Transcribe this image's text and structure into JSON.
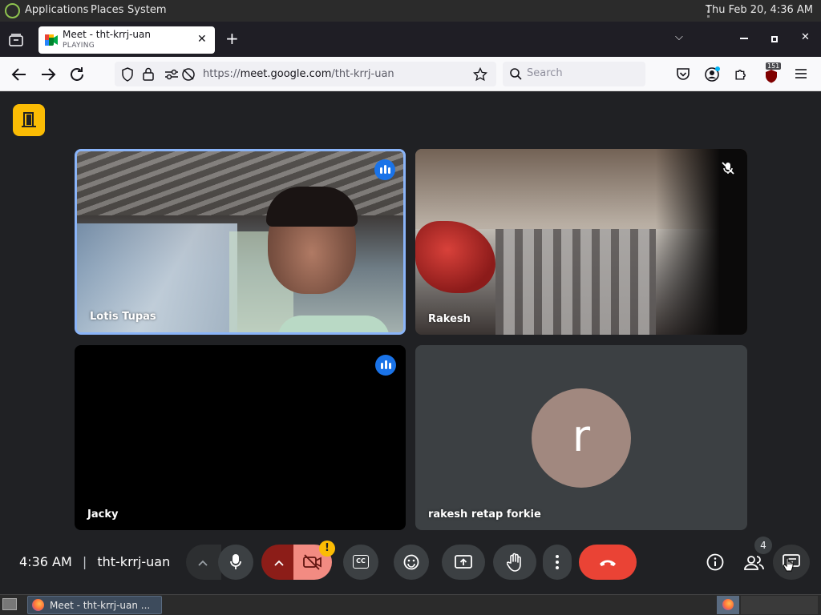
{
  "topbar": {
    "menus": [
      "Applications",
      "Places",
      "System"
    ],
    "clock": "Thu Feb 20,  4:36 AM"
  },
  "browser": {
    "tab": {
      "title": "Meet - tht-krrj-uan",
      "status": "PLAYING"
    },
    "url_prefix": "https://",
    "url_host": "meet.google.com",
    "url_path": "/tht-krrj-uan",
    "search_placeholder": "Search",
    "ext_badge": "151"
  },
  "meet": {
    "participants": [
      {
        "name": "Lotis Tupas"
      },
      {
        "name": "Rakesh"
      },
      {
        "name": "Jacky"
      },
      {
        "name": "rakesh retap forkie",
        "avatar_letter": "r"
      }
    ],
    "time": "4:36 AM",
    "separator": "|",
    "meeting_code": "tht-krrj-uan",
    "people_count": "4",
    "camera_warning": "!",
    "cc_label": "CC"
  },
  "taskbar": {
    "window_title": "Meet - tht-krrj-uan ..."
  },
  "colors": {
    "accent": "#1a73e8",
    "end_call": "#ea4335",
    "camera_off": "#f28b82",
    "dark_red": "#8c1d18",
    "warning": "#fbbc04"
  }
}
